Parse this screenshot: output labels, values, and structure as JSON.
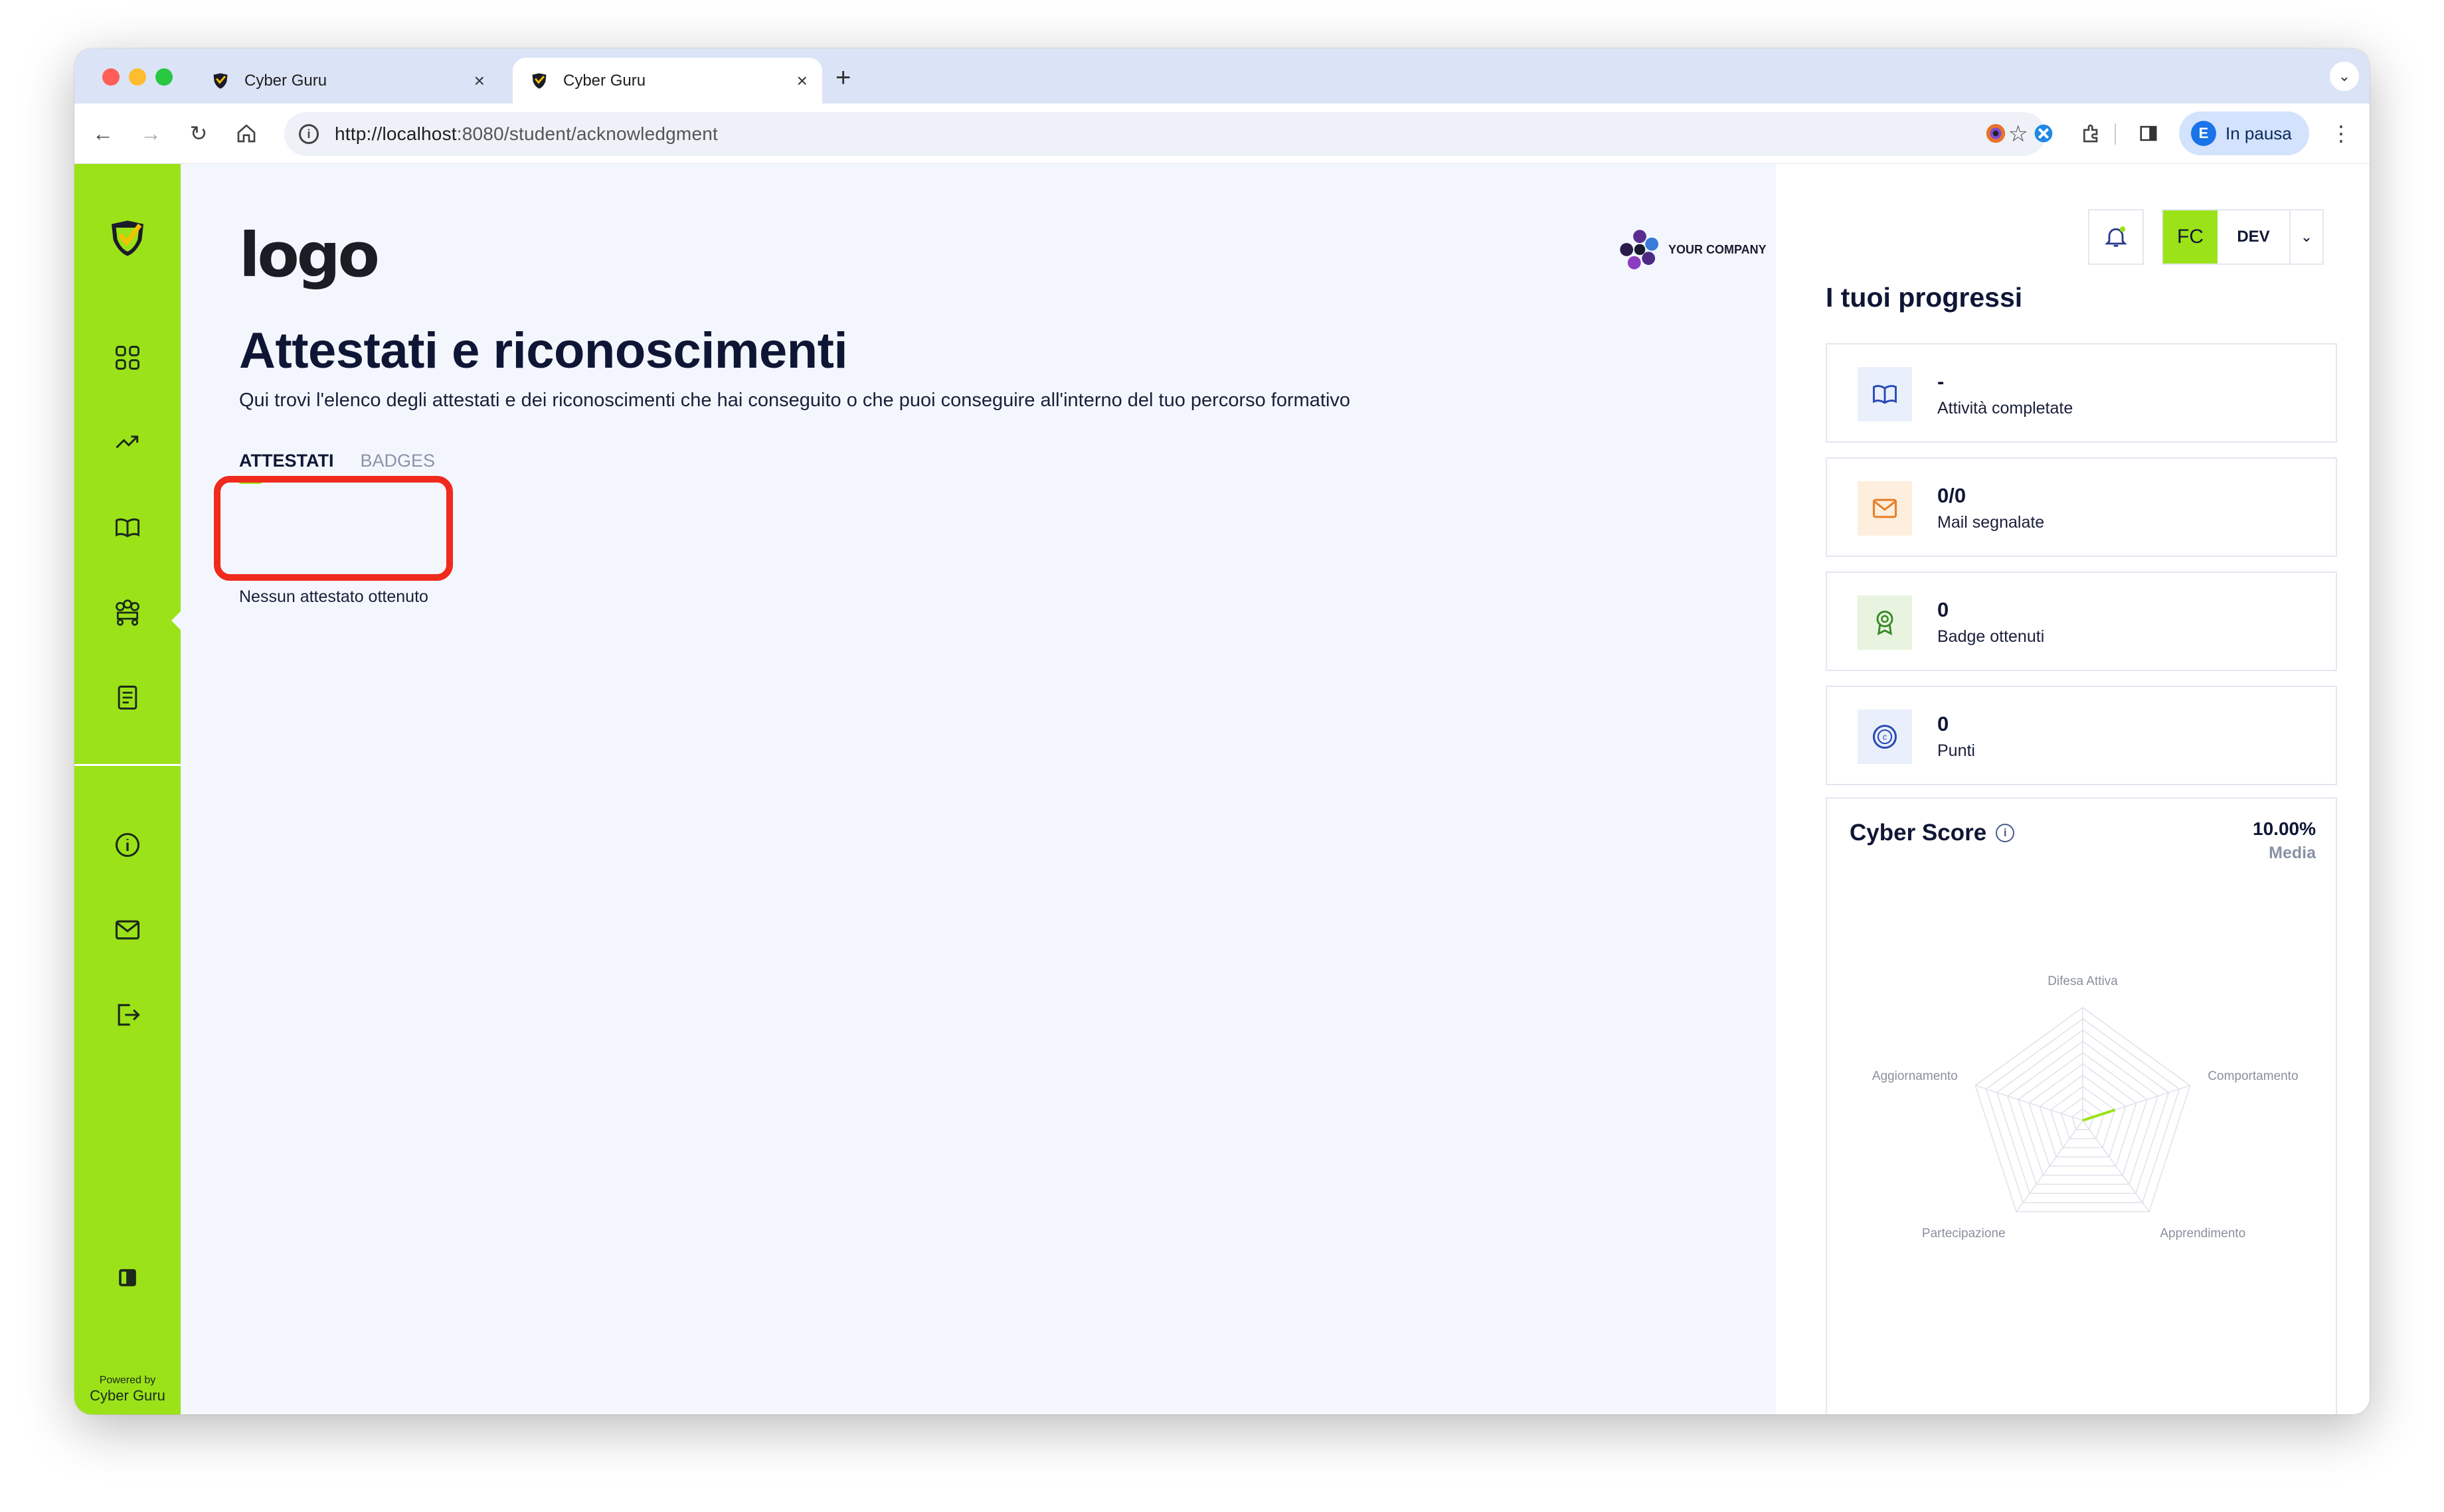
{
  "browser": {
    "tabs": [
      {
        "title": "Cyber Guru",
        "active": false
      },
      {
        "title": "Cyber Guru",
        "active": true
      }
    ],
    "url_host": "http://localhost",
    "url_rest": ":8080/student/acknowledgment",
    "profile_label": "In pausa",
    "profile_initial": "E"
  },
  "sidebar": {
    "items": [
      "dashboard",
      "progress",
      "courses",
      "acknowledgments",
      "documents",
      "info",
      "mail",
      "logout",
      "toggle-sidebar"
    ],
    "powered_by": "Powered by",
    "brand": "Cyber Guru"
  },
  "main": {
    "logo_text": "logo",
    "company_name": "YOUR COMPANY",
    "title": "Attestati e riconoscimenti",
    "subtitle": "Qui trovi l'elenco degli attestati e dei riconoscimenti che hai conseguito o che puoi conseguire all'interno del tuo percorso formativo",
    "tabs": [
      {
        "label": "ATTESTATI",
        "active": true
      },
      {
        "label": "BADGES",
        "active": false
      }
    ],
    "empty_message": "Nessun attestato ottenuto"
  },
  "right": {
    "user_initials": "FC",
    "user_role": "DEV",
    "title": "I tuoi progressi",
    "cards": [
      {
        "value": "-",
        "label": "Attività completate",
        "icon": "book-icon"
      },
      {
        "value": "0/0",
        "label": "Mail segnalate",
        "icon": "mail-icon"
      },
      {
        "value": "0",
        "label": "Badge ottenuti",
        "icon": "badge-icon"
      },
      {
        "value": "0",
        "label": "Punti",
        "icon": "coin-icon"
      }
    ],
    "cyber_score": {
      "title": "Cyber Score",
      "value": "10.00%",
      "sub": "Media"
    }
  },
  "chart_data": {
    "type": "radar",
    "axes": [
      "Difesa Attiva",
      "Comportamento",
      "Apprendimento",
      "Partecipazione",
      "Aggiornamento"
    ],
    "values": [
      0,
      0.3,
      0,
      0,
      0
    ],
    "levels": 10
  },
  "colors": {
    "accent": "#9be219",
    "highlight": "#f02a1c",
    "text": "#0f1635"
  }
}
